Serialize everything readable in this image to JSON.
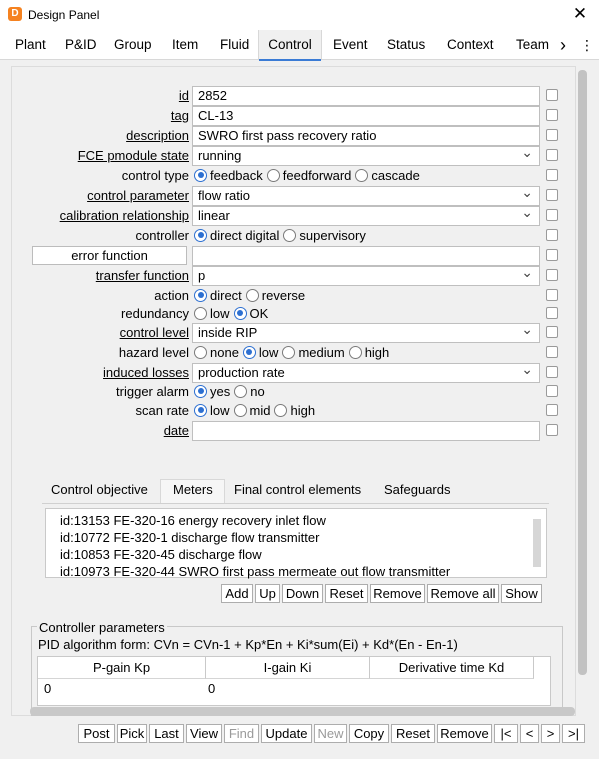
{
  "window": {
    "title": "Design Panel",
    "app_icon": "app-logo-icon",
    "close_glyph": "✕"
  },
  "tabs": [
    "Plant",
    "P&ID",
    "Group",
    "Item",
    "Fluid",
    "Control",
    "Event",
    "Status",
    "Context",
    "Team"
  ],
  "active_tab": "Control",
  "tab_overflow_glyph": "›",
  "form": {
    "id": {
      "label": "id",
      "value": "2852"
    },
    "tag": {
      "label": "tag",
      "value": "CL-13"
    },
    "description": {
      "label": "description",
      "value": "SWRO first pass recovery ratio"
    },
    "fce_state": {
      "label": "FCE pmodule state",
      "value": "running"
    },
    "control_type": {
      "label": "control type",
      "options": [
        "feedback",
        "feedforward",
        "cascade"
      ],
      "selected": "feedback"
    },
    "control_parameter": {
      "label": "control parameter",
      "value": "flow ratio"
    },
    "calibration": {
      "label": "calibration relationship",
      "value": "linear"
    },
    "controller": {
      "label": "controller",
      "options": [
        "direct digital",
        "supervisory"
      ],
      "selected": "direct digital"
    },
    "error_function": {
      "label": "error function",
      "value": ""
    },
    "transfer_function": {
      "label": "transfer function",
      "value": "p"
    },
    "action": {
      "label": "action",
      "options": [
        "direct",
        "reverse"
      ],
      "selected": "direct"
    },
    "redundancy": {
      "label": "redundancy",
      "options": [
        "low",
        "OK"
      ],
      "selected": "OK"
    },
    "control_level": {
      "label": "control level",
      "value": "inside RIP"
    },
    "hazard_level": {
      "label": "hazard level",
      "options": [
        "none",
        "low",
        "medium",
        "high"
      ],
      "selected": "low"
    },
    "induced_losses": {
      "label": "induced losses",
      "value": "production rate"
    },
    "trigger_alarm": {
      "label": "trigger alarm",
      "options": [
        "yes",
        "no"
      ],
      "selected": "yes"
    },
    "scan_rate": {
      "label": "scan rate",
      "options": [
        "low",
        "mid",
        "high"
      ],
      "selected": "low"
    },
    "date": {
      "label": "date",
      "value": ""
    }
  },
  "subtabs": [
    "Control objective",
    "Meters",
    "Final control elements",
    "Safeguards"
  ],
  "active_subtab": "Meters",
  "meters": [
    "id:13153 FE-320-16 energy recovery inlet flow",
    "id:10772 FE-320-1 discharge flow transmitter",
    "id:10853 FE-320-45 discharge flow",
    "id:10973 FE-320-44 SWRO first pass mermeate out flow transmitter"
  ],
  "list_buttons": [
    "Add",
    "Up",
    "Down",
    "Reset",
    "Remove",
    "Remove all",
    "Show"
  ],
  "controller_params": {
    "title": "Controller parameters",
    "formula": "PID algorithm form: CVn = CVn-1 + Kp*En + Ki*sum(Ei) + Kd*(En - En-1)",
    "columns": [
      "P-gain Kp",
      "I-gain Ki",
      "Derivative time Kd"
    ],
    "values": [
      "0",
      "0",
      ""
    ]
  },
  "bottom_buttons": [
    "Post",
    "Pick",
    "Last",
    "View",
    "Find",
    "Update",
    "New",
    "Copy",
    "Reset",
    "Remove",
    "|<",
    "<",
    ">",
    ">|"
  ],
  "disabled_buttons": [
    "Find",
    "New"
  ]
}
